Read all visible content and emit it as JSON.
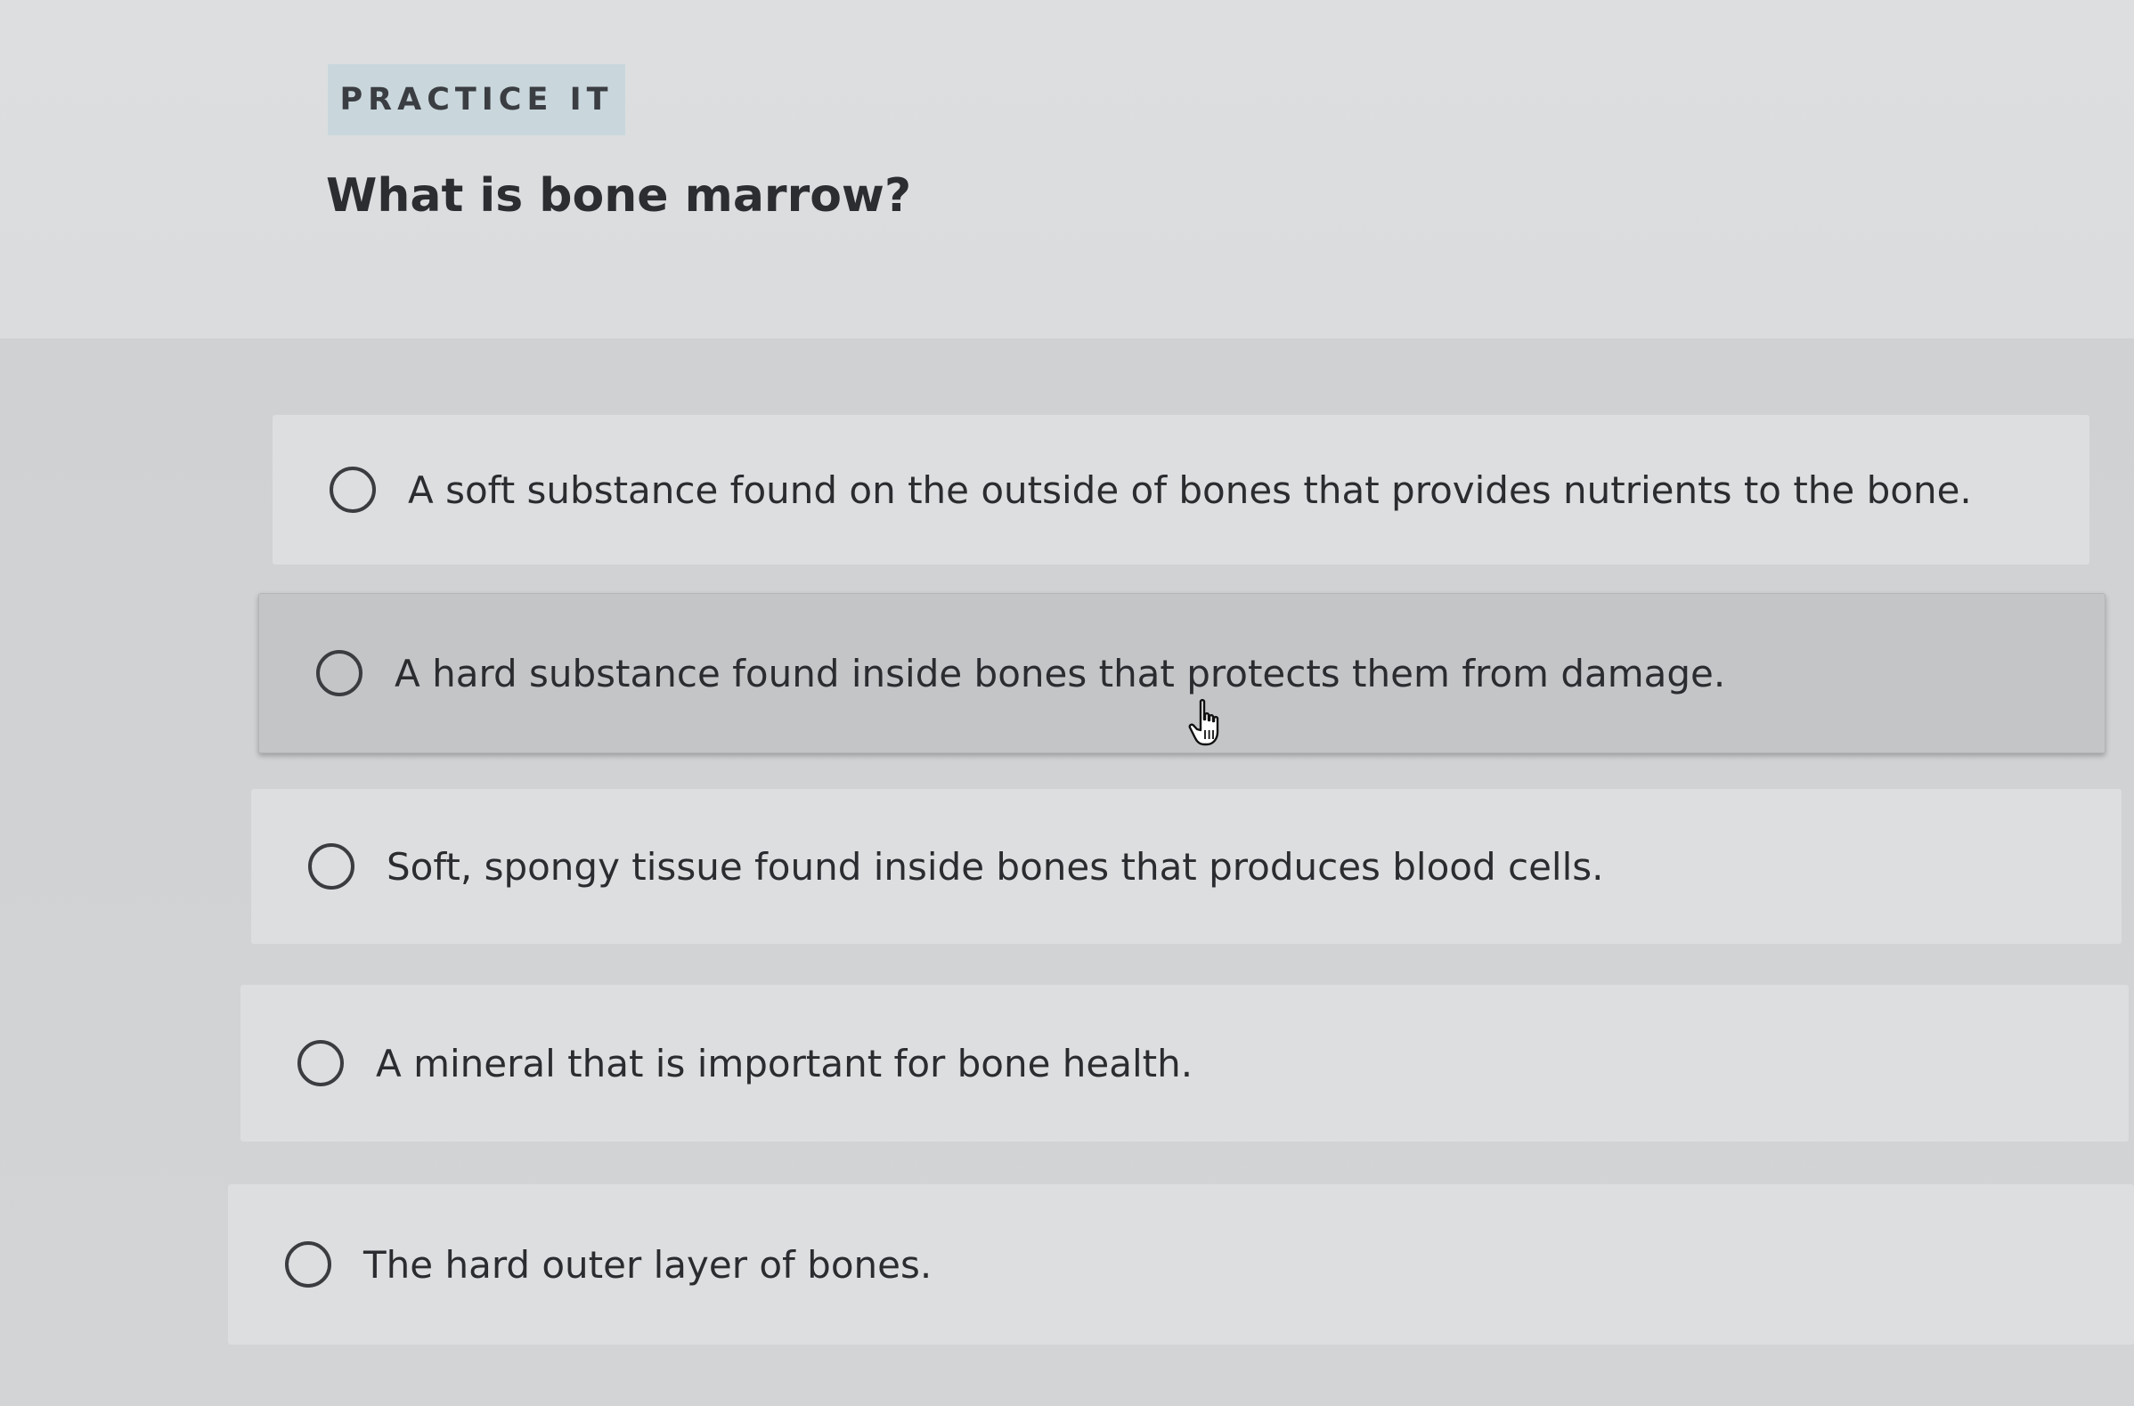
{
  "section_badge": "PRACTICE IT",
  "question": "What is bone marrow?",
  "options": [
    {
      "label": "A soft substance found on the outside of bones that provides nutrients to the bone.",
      "selected": false
    },
    {
      "label": "A hard substance found inside bones that protects them from damage.",
      "selected": false,
      "hovered": true
    },
    {
      "label": "Soft, spongy tissue found inside bones that produces blood cells.",
      "selected": false
    },
    {
      "label": "A mineral that is important for bone health.",
      "selected": false
    },
    {
      "label": "The hard outer layer of bones.",
      "selected": false
    }
  ],
  "cursor": "hand-pointer-icon"
}
